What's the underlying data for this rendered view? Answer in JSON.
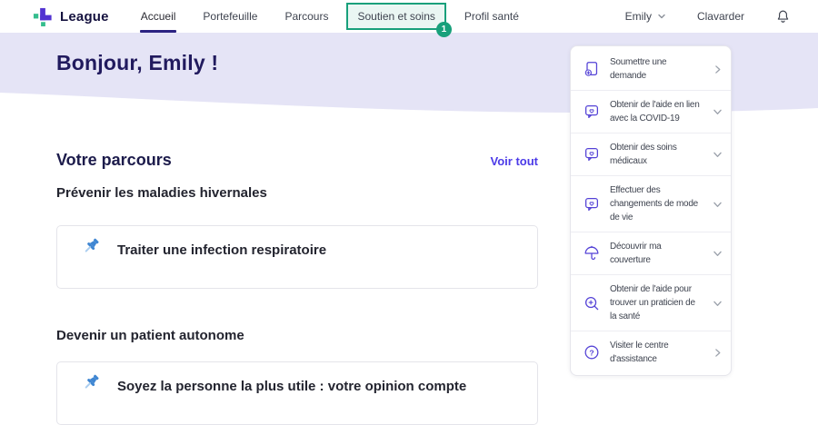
{
  "brand": {
    "name": "League"
  },
  "nav": {
    "items": [
      {
        "label": "Accueil",
        "active": true
      },
      {
        "label": "Portefeuille",
        "active": false
      },
      {
        "label": "Parcours",
        "active": false
      },
      {
        "label": "Soutien et soins",
        "active": false,
        "annotated": true
      },
      {
        "label": "Profil santé",
        "active": false
      }
    ],
    "user_menu": {
      "name": "Emily"
    },
    "chat_label": "Clavarder"
  },
  "annotation": {
    "step_badge": "1"
  },
  "hero": {
    "greeting": "Bonjour, Emily !"
  },
  "journey": {
    "title": "Votre parcours",
    "view_all_label": "Voir tout",
    "groups": [
      {
        "heading": "Prévenir les maladies hivernales",
        "cards": [
          {
            "title": "Traiter une infection respiratoire",
            "icon": "pushpin-icon"
          }
        ]
      },
      {
        "heading": "Devenir un patient autonome",
        "cards": [
          {
            "title": "Soyez la personne la plus utile : votre opinion compte",
            "icon": "pushpin-icon"
          }
        ]
      }
    ]
  },
  "support_panel": {
    "items": [
      {
        "label": "Soumettre une demande",
        "icon": "document-add-icon",
        "chevron": "right"
      },
      {
        "label": "Obtenir de l'aide en lien avec la COVID-19",
        "icon": "chat-heart-icon",
        "chevron": "down"
      },
      {
        "label": "Obtenir des soins médicaux",
        "icon": "chat-heart-icon",
        "chevron": "down"
      },
      {
        "label": "Effectuer des changements de mode de vie",
        "icon": "chat-heart-icon",
        "chevron": "down"
      },
      {
        "label": "Découvrir ma couverture",
        "icon": "umbrella-icon",
        "chevron": "down"
      },
      {
        "label": "Obtenir de l'aide pour trouver un praticien de la santé",
        "icon": "search-plus-icon",
        "chevron": "down"
      },
      {
        "label": "Visiter le centre d'assistance",
        "icon": "help-circle-icon",
        "chevron": "right"
      }
    ]
  },
  "colors": {
    "accent_purple": "#5442D6",
    "brand_purple": "#5233D1",
    "brand_green": "#35BD8D",
    "link_purple": "#4B3AE8",
    "annotation_green": "#18A07B",
    "hero_lavender": "#E5E4F6",
    "pin_blue": "#3F86D2",
    "heading_navy": "#211A5E"
  }
}
